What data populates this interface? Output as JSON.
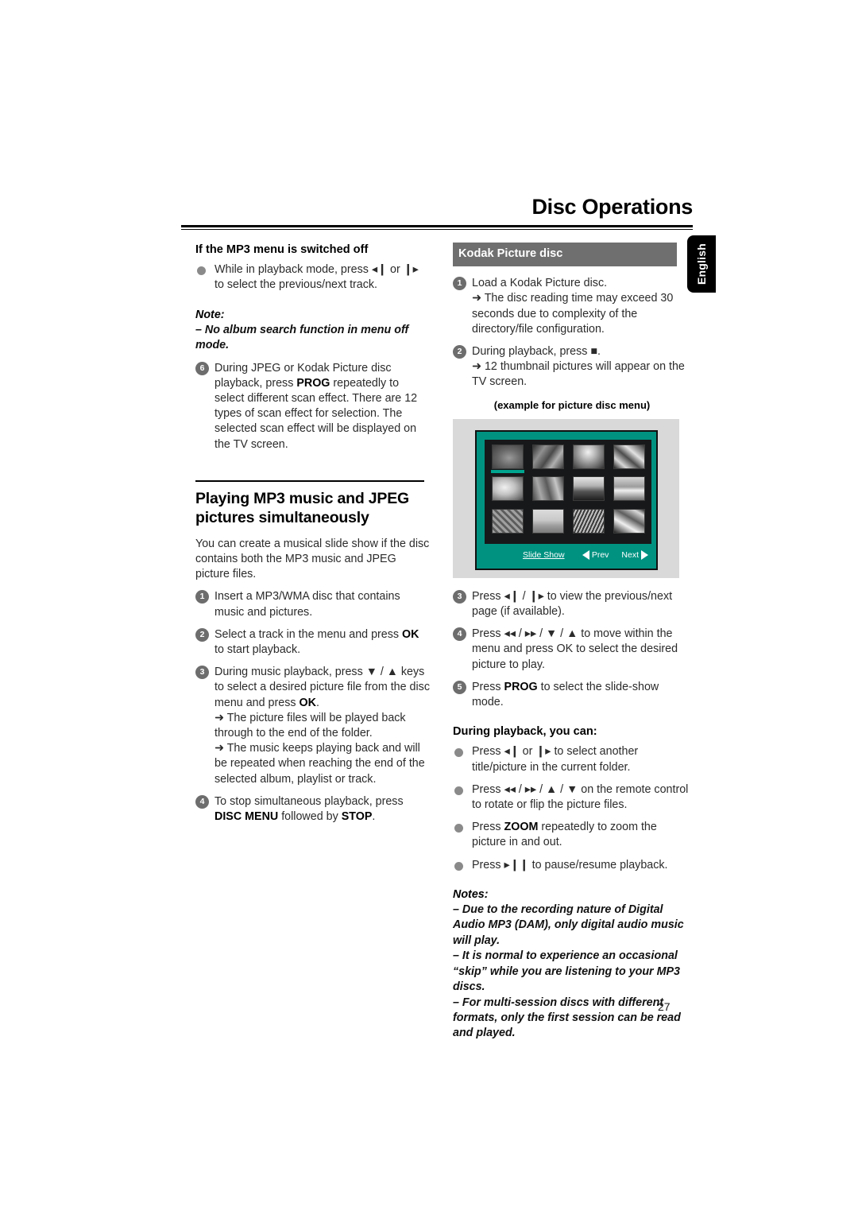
{
  "header": {
    "title": "Disc Operations"
  },
  "lang_tab": {
    "label": "English"
  },
  "page_number": "27",
  "left_column": {
    "heading_1": "If the MP3 menu is switched off",
    "bullet_1": "While in playback mode, press ◂❙ or ❙▸ to select the previous/next track.",
    "note_label": "Note:",
    "note_1": "–  No album search function in menu off mode.",
    "step_6_marker": "6",
    "step_6_a": "During JPEG or Kodak Picture disc playback,",
    "step_6_b_pre": "press ",
    "step_6_b_bold": "PROG",
    "step_6_b_post": " repeatedly to select different scan effect. There are 12 types of scan effect for selection. The selected scan effect will be displayed on the TV screen.",
    "section_title": "Playing MP3 music and JPEG pictures simultaneously",
    "intro": "You can create a musical slide show if the disc contains both the MP3 music and JPEG picture files.",
    "step_1_marker": "1",
    "step_1": "Insert a MP3/WMA disc that contains music and pictures.",
    "step_2_marker": "2",
    "step_2_pre": "Select a track in the menu and press ",
    "step_2_bold": "OK",
    "step_2_post": " to start playback.",
    "step_3_marker": "3",
    "step_3_pre": "During music playback, press ▼ / ▲ keys to select a desired picture file from the disc menu and press ",
    "step_3_bold": "OK",
    "step_3_post": ".",
    "step_3_arrow_1": "➜ The picture files will be played back through to the end of the folder.",
    "step_3_arrow_2": "➜ The music keeps playing back and will be repeated when reaching the end of the selected album, playlist or track.",
    "step_4_marker": "4",
    "step_4_pre": "To stop simultaneous playback, press ",
    "step_4_bold_1": "DISC MENU",
    "step_4_mid": " followed by ",
    "step_4_bold_2": "STOP",
    "step_4_post": "."
  },
  "right_column": {
    "bar_title": "Kodak Picture disc",
    "step_1_marker": "1",
    "step_1": "Load a Kodak Picture disc.",
    "step_1_arrow": "➜ The disc reading time may exceed 30 seconds due to complexity of the directory/file configuration.",
    "step_2_marker": "2",
    "step_2": "During playback, press ■.",
    "step_2_arrow": "➜ 12 thumbnail pictures will appear on the TV screen.",
    "figure_caption": "(example for picture disc menu)",
    "step_3_marker": "3",
    "step_3": "Press ◂❙ / ❙▸ to view the previous/next page (if available).",
    "step_4_marker": "4",
    "step_4": "Press ◂◂ / ▸▸ / ▼ / ▲ to move within the menu and press OK to select the desired picture to play.",
    "step_5_marker": "5",
    "step_5_pre": "Press ",
    "step_5_bold": "PROG",
    "step_5_post": " to select the slide-show mode.",
    "during_playback_heading": "During playback, you can:",
    "bullet_1": "Press ◂❙ or ❙▸ to select another title/picture in the current folder.",
    "bullet_2": "Press ◂◂ / ▸▸ / ▲ / ▼ on the remote control to rotate or flip the picture files.",
    "bullet_3_pre": "Press ",
    "bullet_3_bold": "ZOOM",
    "bullet_3_post": " repeatedly to zoom the picture in and out.",
    "bullet_4": "Press ▸❙❙ to pause/resume playback.",
    "notes_label": "Notes:",
    "note_1": "–  Due to the recording nature of Digital Audio MP3 (DAM), only digital audio music will play.",
    "note_2": "–  It is normal to experience an occasional “skip” while you are listening to your MP3 discs.",
    "note_3": "–  For multi-session discs with different formats, only the first session can be read and played."
  },
  "tv_menu": {
    "slide_show_label": "Slide Show",
    "prev_label": "Prev",
    "next_label": "Next",
    "selected_thumbnail_index": 1,
    "thumbnail_count": 12,
    "screen_color": "#009281",
    "grid_background": "#17181a",
    "figure_background": "#d9d9d9"
  }
}
